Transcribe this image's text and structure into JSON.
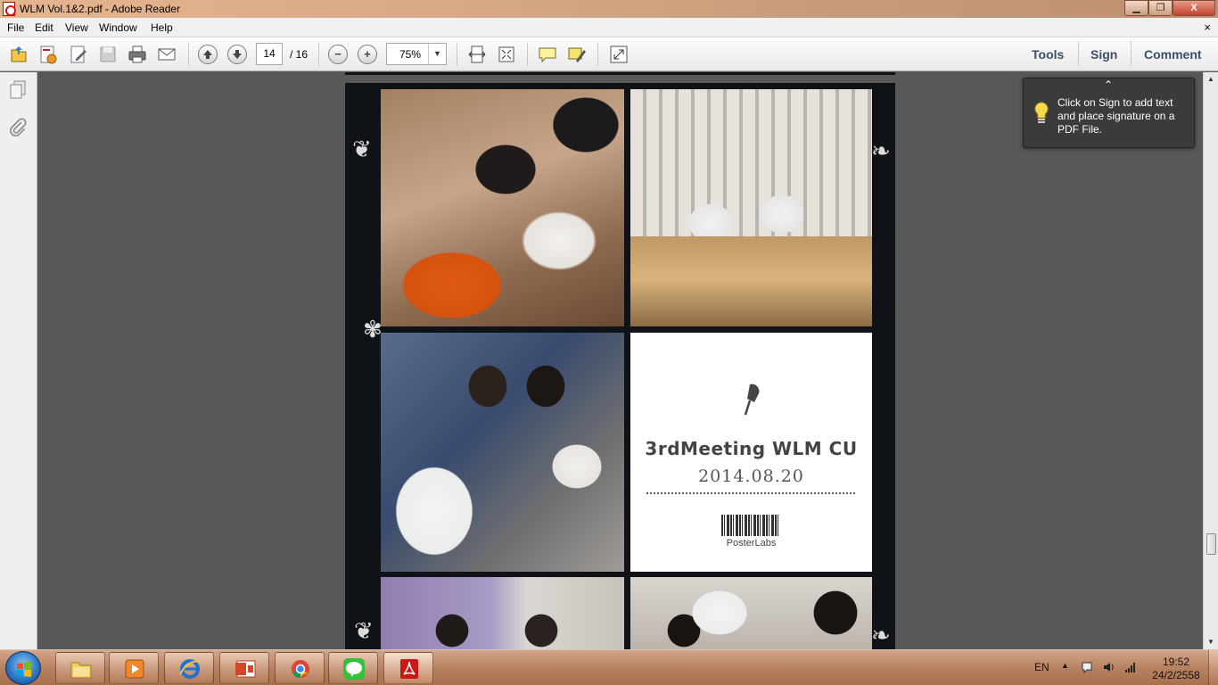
{
  "window": {
    "title": "WLM Vol.1&2.pdf - Adobe Reader",
    "minimize_glyph": "▁",
    "maximize_glyph": "❐",
    "close_glyph": "X"
  },
  "menu": {
    "items": [
      "File",
      "Edit",
      "View",
      "Window",
      "Help"
    ],
    "close_doc_glyph": "×"
  },
  "toolbar": {
    "current_page": "14",
    "total_pages": "/ 16",
    "zoom": "75%",
    "zoom_minus": "−",
    "zoom_plus": "+",
    "tools_label": "Tools",
    "sign_label": "Sign",
    "comment_label": "Comment"
  },
  "tooltip": {
    "text": "Click on Sign to add text and place signature on a PDF File."
  },
  "document": {
    "poster_title": "3rdMeeting WLM CU",
    "poster_date": "2014.08.20",
    "poster_brand": "PosterLabs"
  },
  "taskbar": {
    "language": "EN",
    "time": "19:52",
    "date": "24/2/2558"
  },
  "colors": {
    "accent_link": "#3a5068",
    "taskbar": "#b88262",
    "titlebar": "#d8a884"
  }
}
